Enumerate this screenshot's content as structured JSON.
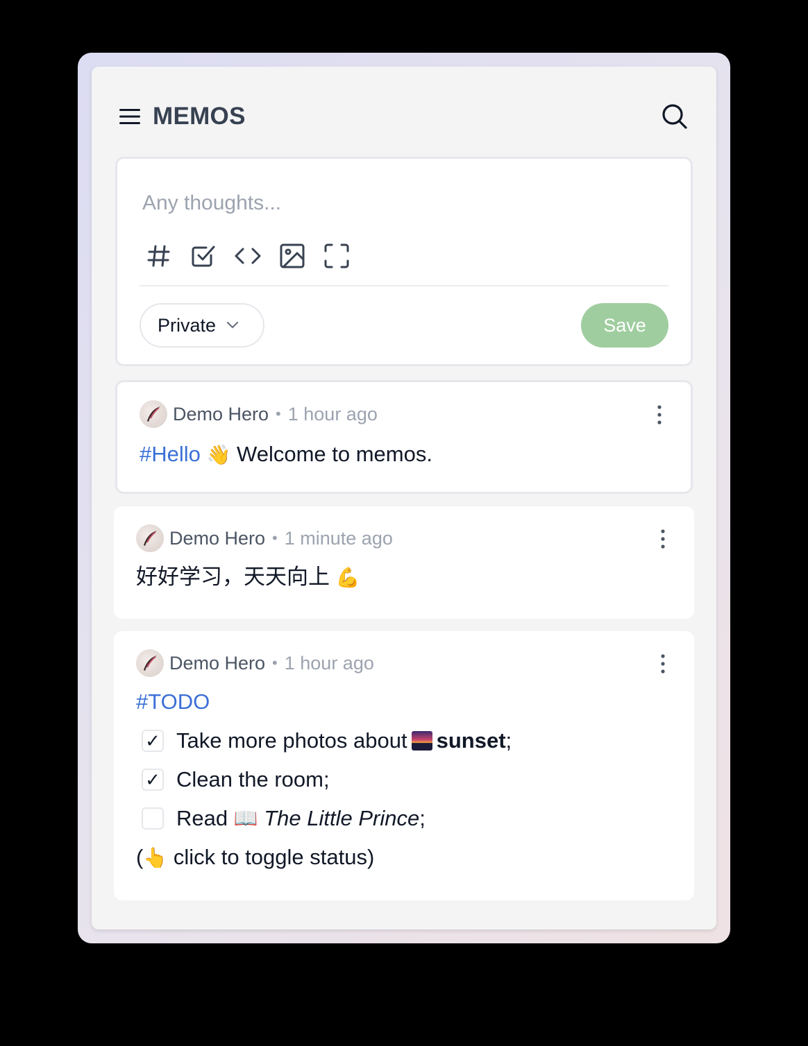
{
  "app": {
    "title": "MEMOS"
  },
  "editor": {
    "placeholder": "Any thoughts...",
    "visibility": "Private",
    "save_label": "Save",
    "tools": [
      "hash-icon",
      "checkbox-icon",
      "code-icon",
      "image-icon",
      "fullscreen-icon"
    ]
  },
  "memos": [
    {
      "author": "Demo Hero",
      "separator": "•",
      "time": "1 hour ago",
      "tag": "#Hello",
      "emoji": "👋",
      "text": "Welcome to memos."
    },
    {
      "author": "Demo Hero",
      "separator": "•",
      "time": "1 minute ago",
      "text": "好好学习，天天向上",
      "emoji": "💪"
    },
    {
      "author": "Demo Hero",
      "separator": "•",
      "time": "1 hour ago",
      "tag": "#TODO",
      "tasks": [
        {
          "checked": true,
          "check_mark": "✓",
          "prefix": "Take more photos about",
          "bold": "sunset",
          "suffix": ";"
        },
        {
          "checked": true,
          "check_mark": "✓",
          "text": "Clean the room;"
        },
        {
          "checked": false,
          "prefix": "Read",
          "book_emoji": "📖",
          "italic": "The Little Prince",
          "suffix": ";"
        }
      ],
      "footer_open": "(",
      "footer_emoji": "👆",
      "footer_text": "click to toggle status)"
    }
  ]
}
